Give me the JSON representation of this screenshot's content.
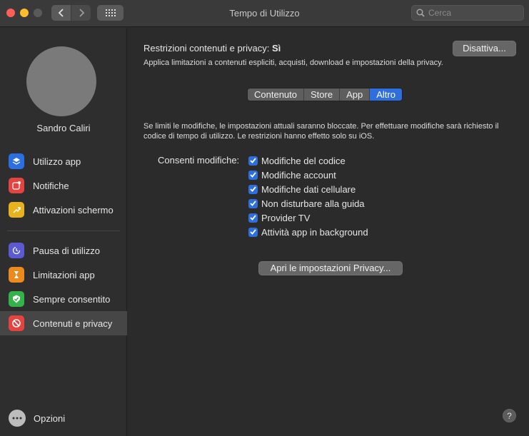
{
  "window": {
    "title": "Tempo di Utilizzo"
  },
  "search": {
    "placeholder": "Cerca",
    "value": ""
  },
  "sidebar": {
    "user_name": "Sandro Caliri",
    "items": [
      {
        "label": "Utilizzo app",
        "icon": "layers-icon",
        "color": "#2c6fe0"
      },
      {
        "label": "Notifiche",
        "icon": "notification-icon",
        "color": "#e5433f"
      },
      {
        "label": "Attivazioni schermo",
        "icon": "pickup-icon",
        "color": "#e8b21e"
      },
      {
        "label": "Pausa di utilizzo",
        "icon": "downtime-icon",
        "color": "#5b5ad3"
      },
      {
        "label": "Limitazioni app",
        "icon": "hourglass-icon",
        "color": "#ea8a1f"
      },
      {
        "label": "Sempre consentito",
        "icon": "checkmark-shield-icon",
        "color": "#34b34a"
      },
      {
        "label": "Contenuti e privacy",
        "icon": "prohibited-icon",
        "color": "#e5433f"
      }
    ],
    "options_label": "Opzioni"
  },
  "main": {
    "restrictions_label": "Restrizioni contenuti e privacy:",
    "restrictions_value": "Sì",
    "restrictions_desc": "Applica limitazioni a contenuti espliciti, acquisti, download e impostazioni della privacy.",
    "disable_button": "Disattiva...",
    "tabs": [
      {
        "label": "Contenuto",
        "selected": false
      },
      {
        "label": "Store",
        "selected": false
      },
      {
        "label": "App",
        "selected": false
      },
      {
        "label": "Altro",
        "selected": true
      }
    ],
    "info_text": "Se limiti le modifiche, le impostazioni attuali saranno bloccate. Per effettuare modifiche sarà richiesto il codice di tempo di utilizzo. Le restrizioni hanno effetto solo su iOS.",
    "allow_label": "Consenti modifiche:",
    "checkboxes": [
      {
        "label": "Modifiche del codice",
        "checked": true
      },
      {
        "label": "Modifiche account",
        "checked": true
      },
      {
        "label": "Modifiche dati cellulare",
        "checked": true
      },
      {
        "label": "Non disturbare alla guida",
        "checked": true
      },
      {
        "label": "Provider TV",
        "checked": true
      },
      {
        "label": "Attività app in background",
        "checked": true
      }
    ],
    "privacy_button": "Apri le impostazioni Privacy...",
    "help_label": "?"
  },
  "colors": {
    "accent": "#2f6fdd",
    "background": "#2b2b2b"
  }
}
